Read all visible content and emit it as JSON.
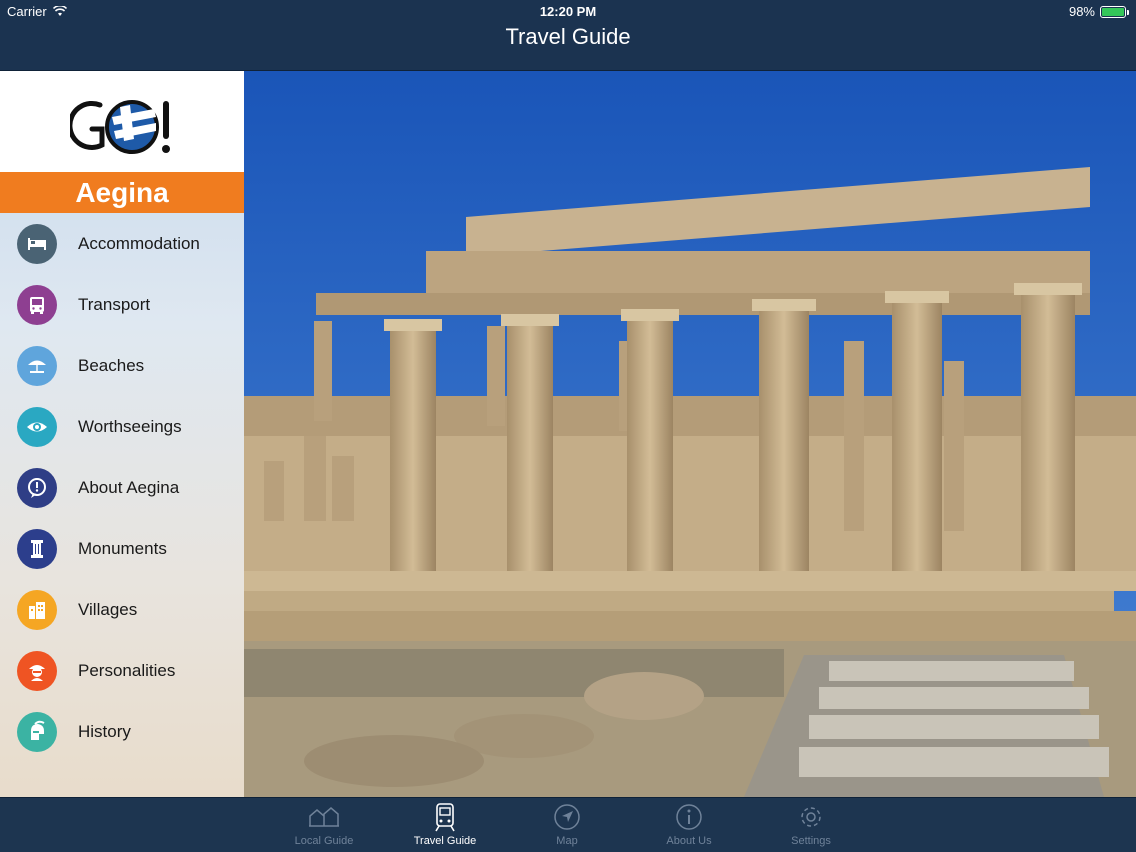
{
  "status_bar": {
    "carrier": "Carrier",
    "time": "12:20 PM",
    "battery": "98%",
    "battery_level": 0.98
  },
  "nav": {
    "title": "Travel Guide"
  },
  "sidebar": {
    "logo_text": "GO!",
    "region": "Aegina",
    "items": [
      {
        "label": "Accommodation",
        "icon": "bed-icon",
        "color": "#4a6374"
      },
      {
        "label": "Transport",
        "icon": "bus-icon",
        "color": "#8e3f91"
      },
      {
        "label": "Beaches",
        "icon": "beach-umbrella-icon",
        "color": "#5fa5dc"
      },
      {
        "label": "Worthseeings",
        "icon": "eye-icon",
        "color": "#2aa8c2"
      },
      {
        "label": "About Aegina",
        "icon": "info-bubble-icon",
        "color": "#2f3e86"
      },
      {
        "label": "Monuments",
        "icon": "column-icon",
        "color": "#2c3e8c"
      },
      {
        "label": "Villages",
        "icon": "buildings-icon",
        "color": "#f5a623"
      },
      {
        "label": "Personalities",
        "icon": "person-icon",
        "color": "#ef5423"
      },
      {
        "label": "History",
        "icon": "helmet-icon",
        "color": "#3bb3a3"
      }
    ]
  },
  "tabs": [
    {
      "label": "Local Guide",
      "icon": "houses-icon",
      "active": false
    },
    {
      "label": "Travel Guide",
      "icon": "train-icon",
      "active": true
    },
    {
      "label": "Map",
      "icon": "compass-arrow-icon",
      "active": false
    },
    {
      "label": "About Us",
      "icon": "info-circle-icon",
      "active": false
    },
    {
      "label": "Settings",
      "icon": "gear-icon",
      "active": false
    }
  ],
  "colors": {
    "bar_bg": "#1b3350",
    "accent_orange": "#f07c1f",
    "tab_active": "#ffffff",
    "tab_inactive": "#6f8299"
  }
}
